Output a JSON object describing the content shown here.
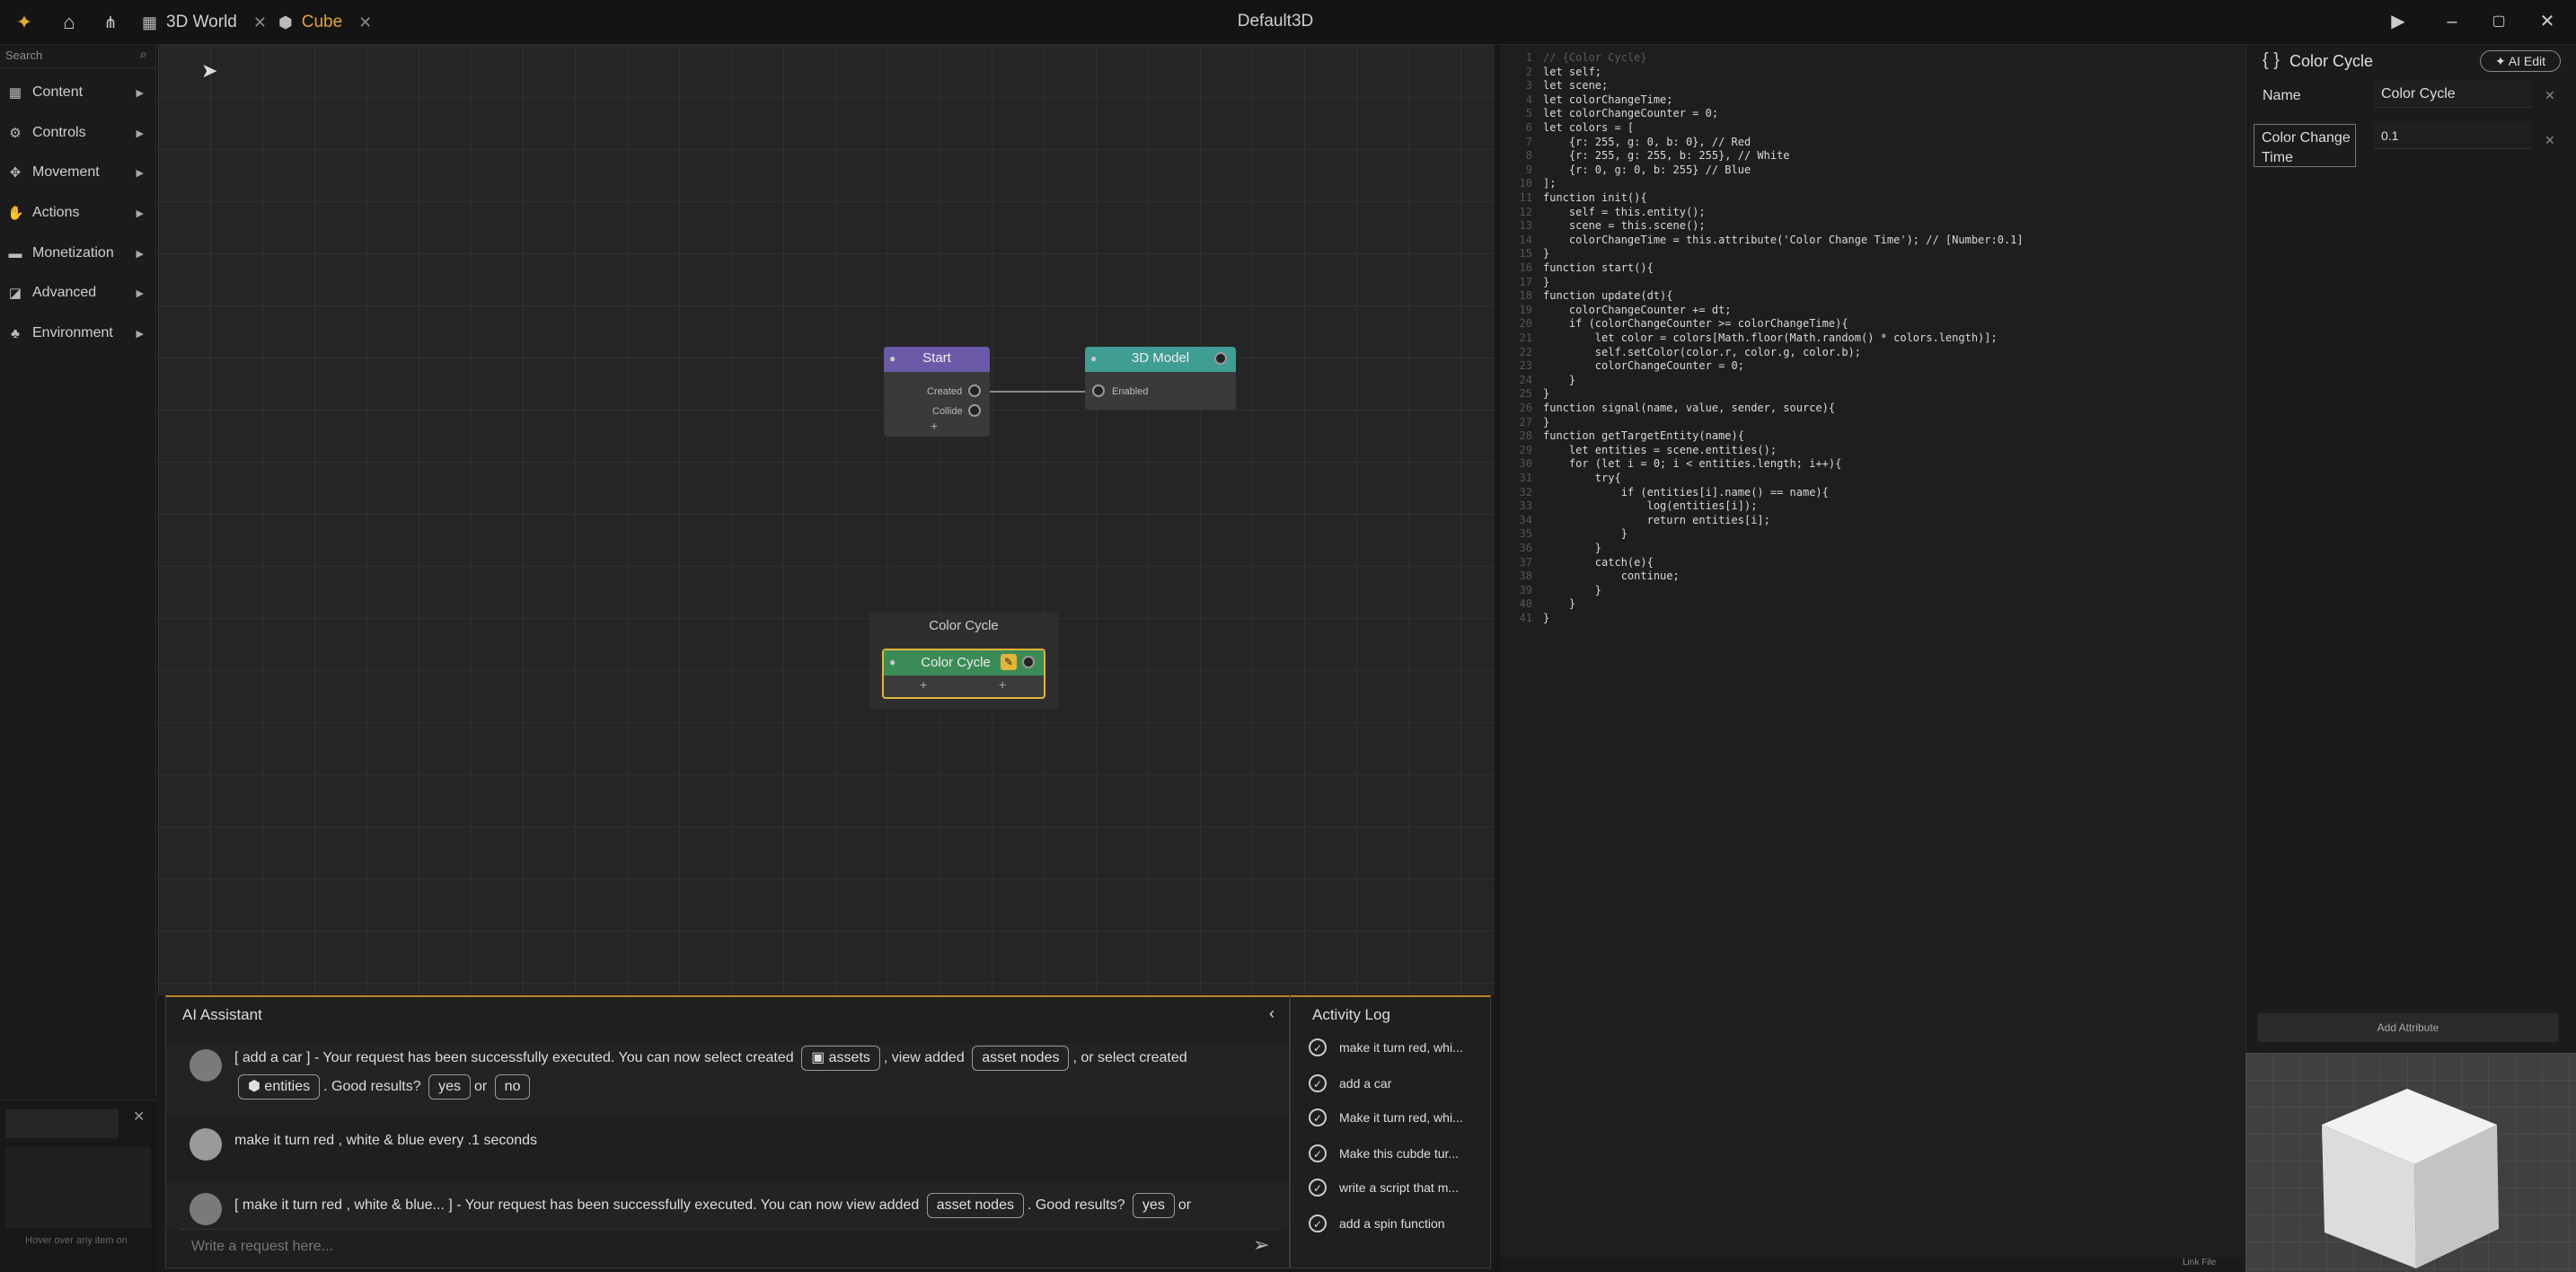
{
  "titlebar": {
    "logo_icon": "logo-icon",
    "tabs": [
      {
        "label": "3D World",
        "icon": "grid-icon",
        "color": "#cfcfcf"
      },
      {
        "label": "Cube",
        "icon": "cube-icon",
        "color": "#e2a530"
      }
    ],
    "window_title": "Default3D"
  },
  "sidebar": {
    "search_placeholder": "Search",
    "items": [
      {
        "label": "Content",
        "icon": "grid-icon"
      },
      {
        "label": "Controls",
        "icon": "controls-icon"
      },
      {
        "label": "Movement",
        "icon": "move-icon"
      },
      {
        "label": "Actions",
        "icon": "actions-icon"
      },
      {
        "label": "Monetization",
        "icon": "coin-icon"
      },
      {
        "label": "Advanced",
        "icon": "advanced-icon"
      },
      {
        "label": "Environment",
        "icon": "environment-icon"
      }
    ],
    "hover_hint": "Hover over any item on"
  },
  "graph": {
    "start_node": {
      "title": "Start",
      "ports": [
        "Created",
        "Collide"
      ]
    },
    "model_node": {
      "title": "3D Model",
      "ports": [
        "Enabled"
      ]
    },
    "color_cycle_group": "Color Cycle",
    "color_cycle_node": {
      "title": "Color Cycle"
    }
  },
  "code": {
    "lines": [
      {
        "n": "1",
        "t": "// {Color Cycle}"
      },
      {
        "n": "2",
        "t": "let self;"
      },
      {
        "n": "3",
        "t": "let scene;"
      },
      {
        "n": "4",
        "t": "let colorChangeTime;"
      },
      {
        "n": "5",
        "t": "let colorChangeCounter = 0;"
      },
      {
        "n": "6",
        "t": "let colors = ["
      },
      {
        "n": "7",
        "t": "    {r: 255, g: 0, b: 0}, // Red"
      },
      {
        "n": "8",
        "t": "    {r: 255, g: 255, b: 255}, // White"
      },
      {
        "n": "9",
        "t": "    {r: 0, g: 0, b: 255} // Blue"
      },
      {
        "n": "10",
        "t": "];"
      },
      {
        "n": "11",
        "t": "function init(){"
      },
      {
        "n": "12",
        "t": "    self = this.entity();"
      },
      {
        "n": "13",
        "t": "    scene = this.scene();"
      },
      {
        "n": "14",
        "t": "    colorChangeTime = this.attribute('Color Change Time'); // [Number:0.1]"
      },
      {
        "n": "15",
        "t": "}"
      },
      {
        "n": "16",
        "t": "function start(){"
      },
      {
        "n": "17",
        "t": "}"
      },
      {
        "n": "18",
        "t": "function update(dt){"
      },
      {
        "n": "19",
        "t": "    colorChangeCounter += dt;"
      },
      {
        "n": "20",
        "t": "    if (colorChangeCounter >= colorChangeTime){"
      },
      {
        "n": "21",
        "t": "        let color = colors[Math.floor(Math.random() * colors.length)];"
      },
      {
        "n": "22",
        "t": "        self.setColor(color.r, color.g, color.b);"
      },
      {
        "n": "23",
        "t": "        colorChangeCounter = 0;"
      },
      {
        "n": "24",
        "t": "    }"
      },
      {
        "n": "25",
        "t": "}"
      },
      {
        "n": "26",
        "t": "function signal(name, value, sender, source){"
      },
      {
        "n": "27",
        "t": "}"
      },
      {
        "n": "28",
        "t": "function getTargetEntity(name){"
      },
      {
        "n": "29",
        "t": "    let entities = scene.entities();"
      },
      {
        "n": "30",
        "t": "    for (let i = 0; i < entities.length; i++){"
      },
      {
        "n": "31",
        "t": "        try{"
      },
      {
        "n": "32",
        "t": "            if (entities[i].name() == name){"
      },
      {
        "n": "33",
        "t": "                log(entities[i]);"
      },
      {
        "n": "34",
        "t": "                return entities[i];"
      },
      {
        "n": "35",
        "t": "            }"
      },
      {
        "n": "36",
        "t": "        }"
      },
      {
        "n": "37",
        "t": "        catch(e){"
      },
      {
        "n": "38",
        "t": "            continue;"
      },
      {
        "n": "39",
        "t": "        }"
      },
      {
        "n": "40",
        "t": "    }"
      },
      {
        "n": "41",
        "t": "}"
      }
    ]
  },
  "properties": {
    "title": "Color Cycle",
    "ai_edit_label": "AI Edit",
    "name_label": "Name",
    "name_value": "Color Cycle",
    "attr_label": "Color Change Time",
    "attr_value": "0.1",
    "add_attribute_label": "Add Attribute"
  },
  "assistant": {
    "title": "AI Assistant",
    "msg1": {
      "prefix": "[ add a car ] - Your request has been successfully executed. You can now select created",
      "chip_assets": "assets",
      "mid1": ", view added",
      "chip_asset_nodes": "asset nodes",
      "mid2": ", or select created",
      "chip_entities": "entities",
      "good": ". Good results?",
      "chip_yes": "yes",
      "or": "or",
      "chip_no": "no"
    },
    "msg2": "make it turn red , white & blue every .1 seconds",
    "msg3": {
      "prefix": "[ make it turn red , white & blue... ] - Your request has been successfully executed. You can now view added",
      "chip_asset_nodes": "asset nodes",
      "good": ". Good results?",
      "chip_yes": "yes",
      "or": "or"
    },
    "input_placeholder": "Write a request here..."
  },
  "activity": {
    "title": "Activity Log",
    "items": [
      "make it turn red, whi...",
      "add a car",
      "Make it turn red, whi...",
      "Make this cubde tur...",
      "write a script that m...",
      "add a spin function"
    ]
  },
  "status": {
    "right": "Link File"
  }
}
